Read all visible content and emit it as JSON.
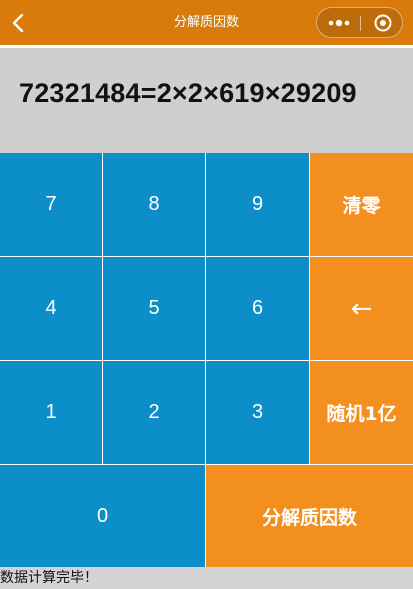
{
  "navbar": {
    "title": "分解质因数",
    "background_color": "#d97b0b",
    "back_icon": "chevron-left-icon",
    "more_icon": "more-dots-icon",
    "close_icon": "target-circle-icon"
  },
  "display": {
    "expression": "72321484=2×2×619×29209"
  },
  "keypad": {
    "key_7": "7",
    "key_8": "8",
    "key_9": "9",
    "clear": "清零",
    "key_4": "4",
    "key_5": "5",
    "key_6": "6",
    "backspace": "←",
    "key_1": "1",
    "key_2": "2",
    "key_3": "3",
    "random": "随机1亿",
    "key_0": "0",
    "factorize": "分解质因数",
    "number_key_color": "#0c8fc8",
    "function_key_color": "#f38f1f"
  },
  "status": {
    "message": "数据计算完毕！"
  }
}
